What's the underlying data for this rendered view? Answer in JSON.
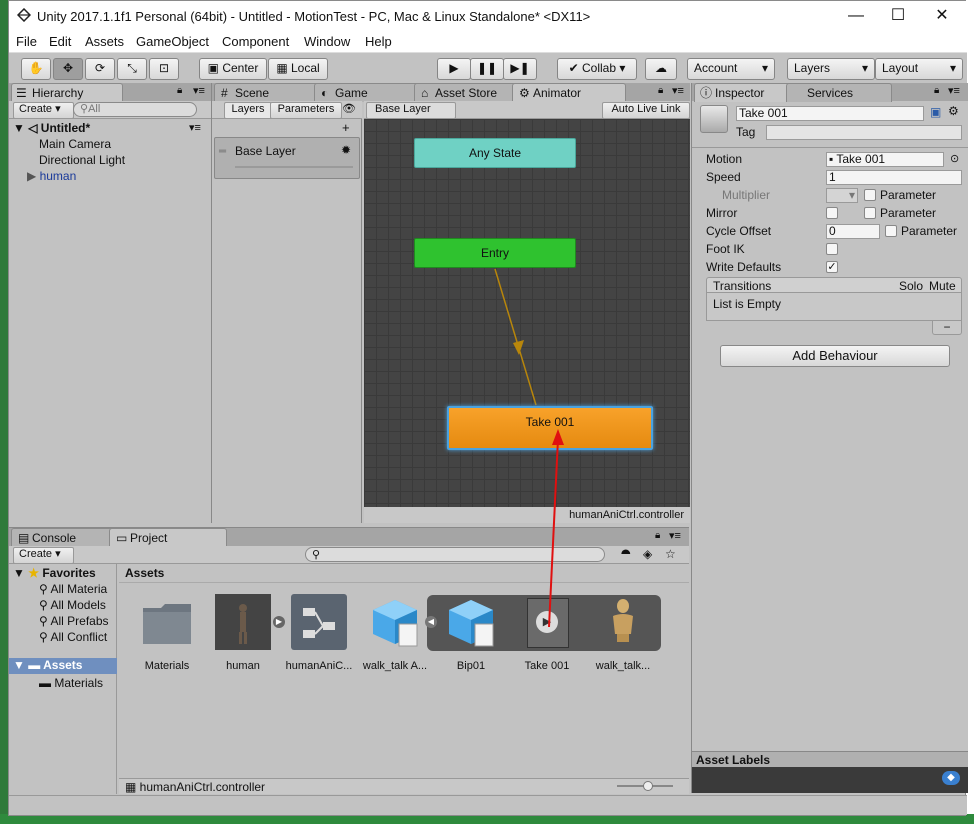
{
  "window": {
    "title": "Unity 2017.1.1f1 Personal (64bit) - Untitled - MotionTest - PC, Mac & Linux Standalone* <DX11>",
    "controls": [
      "—",
      "☐",
      "✕"
    ]
  },
  "menu": [
    "File",
    "Edit",
    "Assets",
    "GameObject",
    "Component",
    "Window",
    "Help"
  ],
  "toolbar": {
    "pivot": "Center",
    "space": "Local",
    "collab": "Collab ▾",
    "account": "Account",
    "layers": "Layers",
    "layout": "Layout"
  },
  "hierarchy": {
    "tab": "Hierarchy",
    "create": "Create ▾",
    "search_placeholder": "All",
    "scene": "Untitled*",
    "items": [
      "Main Camera",
      "Directional Light",
      "human"
    ]
  },
  "center_tabs": [
    "Scene",
    "Game",
    "Asset Store",
    "Animator"
  ],
  "animator": {
    "subtabs": [
      "Layers",
      "Parameters"
    ],
    "breadcrumb": "Base Layer",
    "auto_live_link": "Auto Live Link",
    "layer_name": "Base Layer",
    "states": {
      "any": "Any State",
      "entry": "Entry",
      "take": "Take 001"
    },
    "controller_name": "humanAniCtrl.controller"
  },
  "inspector": {
    "tabs": [
      "Inspector",
      "Services"
    ],
    "name": "Take 001",
    "tag_label": "Tag",
    "fields": {
      "motion_label": "Motion",
      "motion_value": "Take 001",
      "speed_label": "Speed",
      "speed_value": "1",
      "multiplier_label": "Multiplier",
      "parameter_label": "Parameter",
      "mirror_label": "Mirror",
      "cycle_label": "Cycle Offset",
      "cycle_value": "0",
      "footik_label": "Foot IK",
      "writedef_label": "Write Defaults"
    },
    "transitions_header": "Transitions",
    "solo": "Solo",
    "mute": "Mute",
    "list_empty": "List is Empty",
    "minus": "−",
    "add_behaviour": "Add Behaviour",
    "asset_labels": "Asset Labels"
  },
  "bottom_tabs": [
    "Console",
    "Project"
  ],
  "project": {
    "create": "Create ▾",
    "favorites_label": "Favorites",
    "favorites": [
      "All Materia",
      "All Models",
      "All Prefabs",
      "All Conflict"
    ],
    "assets_root": "Assets",
    "assets_children": [
      "Materials"
    ],
    "assets_header": "Assets",
    "items": [
      "Materials",
      "human",
      "humanAniC...",
      "walk_talk A...",
      "Bip01",
      "Take 001",
      "walk_talk..."
    ],
    "status_path": "humanAniCtrl.controller"
  },
  "colors": {
    "any_state": "#6fd1c4",
    "entry": "#2fc22f",
    "take": "#f39a1a",
    "annotation_arrow": "#e01010"
  }
}
